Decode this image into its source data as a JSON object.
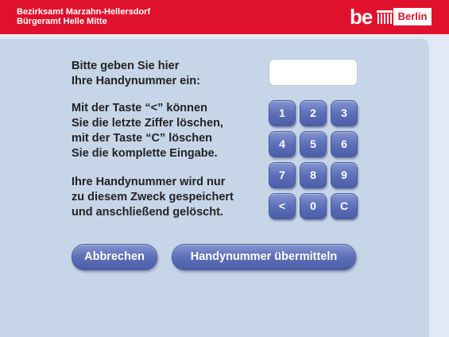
{
  "header": {
    "line1": "Bezirksamt Marzahn-Hellersdorf",
    "line2": "Bürgeramt Helle Mitte",
    "logo_be": "be",
    "logo_berlin": "Berlin"
  },
  "instructions": {
    "prompt": [
      "Bitte geben Sie hier",
      "Ihre Handynummer ein:"
    ],
    "keys_help": [
      "Mit der Taste “<” können",
      "Sie die letzte Ziffer löschen,",
      "mit der Taste “C” löschen",
      "Sie die komplette Eingabe."
    ],
    "privacy": [
      "Ihre Handynummer wird nur",
      "zu diesem Zweck gespeichert",
      "und anschließend gelöscht."
    ]
  },
  "phone_input": {
    "value": ""
  },
  "keypad": [
    [
      "1",
      "2",
      "3"
    ],
    [
      "4",
      "5",
      "6"
    ],
    [
      "7",
      "8",
      "9"
    ],
    [
      "<",
      "0",
      "C"
    ]
  ],
  "buttons": {
    "cancel": "Abbrechen",
    "submit": "Handynummer übermitteln"
  },
  "colors": {
    "header_red": "#e0112d",
    "panel": "#c7d5e8",
    "button_blue": "#5c6fb8"
  }
}
